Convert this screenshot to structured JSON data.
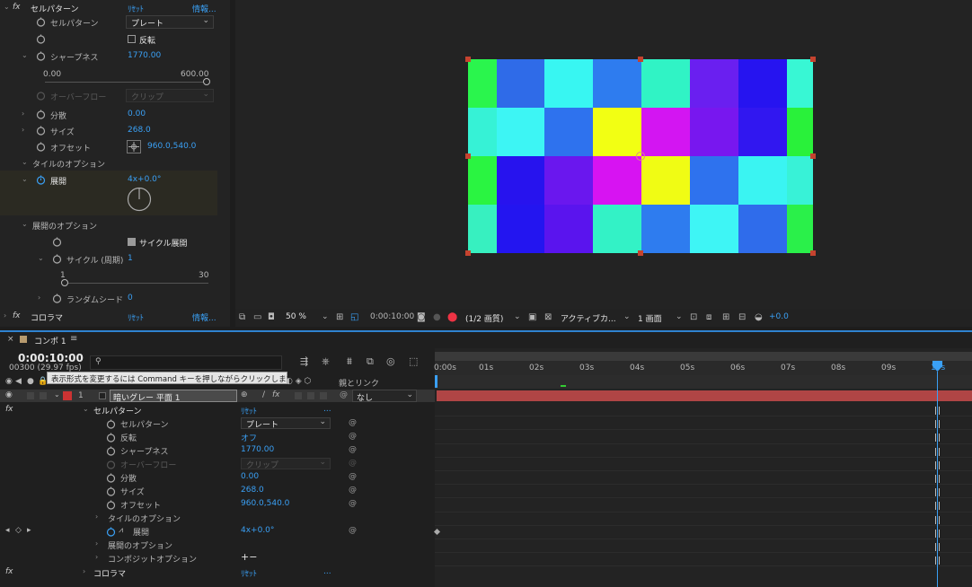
{
  "effects": {
    "fx": "fx",
    "effect_name": "セルパターン",
    "reset": "ﾘｾｯﾄ",
    "info": "情報...",
    "pattern_label": "セルパターン",
    "pattern_value": "プレート",
    "invert_label": "反転",
    "sharpness_label": "シャープネス",
    "sharpness_value": "1770.00",
    "slider_min": "0.00",
    "slider_max": "600.00",
    "overflow_label": "オーバーフロー",
    "overflow_value": "クリップ",
    "disperse_label": "分散",
    "disperse_value": "0.00",
    "size_label": "サイズ",
    "size_value": "268.0",
    "offset_label": "オフセット",
    "offset_value": "960.0,540.0",
    "tile_options": "タイルのオプション",
    "evolution_label": "展開",
    "evolution_value": "4x+0.0°",
    "evolution_options": "展開のオプション",
    "cycle_evolution": "サイクル展開",
    "cycle_label": "サイクル (周期)",
    "cycle_value": "1",
    "cycle_min": "1",
    "cycle_max": "30",
    "random_seed_label": "ランダムシード",
    "random_seed_value": "0",
    "effect2_name": "コロラマ",
    "effect2_reset": "ﾘｾｯﾄ",
    "effect2_info": "情報..."
  },
  "preview": {
    "grid": [
      [
        "#2af54d",
        "#2f6be8",
        "#38f6f2",
        "#2e7cef",
        "#30f3c5",
        "#6a1ff0",
        "#2614f0",
        "#38f7d4"
      ],
      [
        "#36f2d6",
        "#3df5f4",
        "#2e72ee",
        "#f2ff13",
        "#d315f2",
        "#7817ef",
        "#3117f0",
        "#29f13a"
      ],
      [
        "#2af441",
        "#2713ee",
        "#6a17ee",
        "#d713f2",
        "#f0fc14",
        "#2e72ee",
        "#3af4f2",
        "#38f2d7"
      ],
      [
        "#37f0c0",
        "#2315f0",
        "#5a14ee",
        "#33f2c6",
        "#2e7cef",
        "#3ef5f5",
        "#2f6ceb",
        "#2af04a"
      ]
    ],
    "toolbar": {
      "zoom": "50 %",
      "time": "0:00:10:00",
      "resolution": "(1/2 画質)",
      "camera": "アクティブカ...",
      "views": "1 画面",
      "exposure": "+0.0"
    }
  },
  "timeline": {
    "tab_label": "コンポ 1",
    "menu_icon": "≡",
    "timecode": "0:00:10:00",
    "frames": "00300 (29.97 fps)",
    "tooltip": "表示形式を変更するには Command キーを押しながらクリックします",
    "parent_link_header": "親とリンク",
    "ruler": [
      "0:00s",
      "01s",
      "02s",
      "03s",
      "04s",
      "05s",
      "06s",
      "07s",
      "08s",
      "09s",
      "10s"
    ],
    "layer_number": "1",
    "layer_name": "暗いグレー 平面 1",
    "parent_value": "なし",
    "fx": "fx",
    "effect_name": "セルパターン",
    "reset": "ﾘｾｯﾄ",
    "more": "...",
    "props": {
      "pattern_label": "セルパターン",
      "pattern_value": "プレート",
      "invert_label": "反転",
      "invert_value": "オフ",
      "sharpness_label": "シャープネス",
      "sharpness_value": "1770.00",
      "overflow_label": "オーバーフロー",
      "overflow_value": "クリップ",
      "disperse_label": "分散",
      "disperse_value": "0.00",
      "size_label": "サイズ",
      "size_value": "268.0",
      "offset_label": "オフセット",
      "offset_value": "960.0,540.0",
      "tile_options": "タイルのオプション",
      "evolution_label": "展開",
      "evolution_value": "4x+0.0°",
      "evolution_options": "展開のオプション",
      "composite_options": "コンポジットオプション",
      "composite_ctrl": "+−"
    },
    "effect2_name": "コロラマ",
    "effect2_reset": "ﾘｾｯﾄ",
    "effect2_more": "..."
  }
}
